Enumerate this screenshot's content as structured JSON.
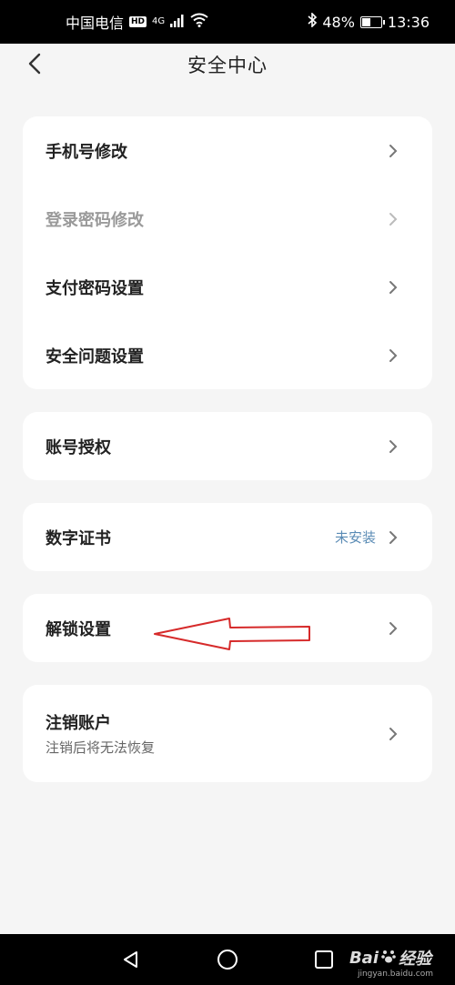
{
  "status_bar": {
    "carrier": "中国电信",
    "hd": "HD",
    "signal_type": "4G",
    "battery": "48%",
    "battery_level": 0.48,
    "time": "13:36"
  },
  "header": {
    "title": "安全中心"
  },
  "cards": {
    "account_group": {
      "items": [
        {
          "label": "手机号修改",
          "disabled": false
        },
        {
          "label": "登录密码修改",
          "disabled": true
        },
        {
          "label": "支付密码设置",
          "disabled": false
        },
        {
          "label": "安全问题设置",
          "disabled": false
        }
      ]
    },
    "authorization": {
      "label": "账号授权"
    },
    "certificate": {
      "label": "数字证书",
      "status": "未安装"
    },
    "unlock": {
      "label": "解锁设置"
    },
    "cancel_account": {
      "label": "注销账户",
      "sublabel": "注销后将无法恢复"
    }
  },
  "colors": {
    "background": "#f5f5f5",
    "card": "#ffffff",
    "status_link": "#5a8bb5",
    "annotation_arrow": "#d62a2a"
  },
  "watermark": {
    "brand": "Bai",
    "brand2": "经验",
    "site": "jingyan.baidu.com"
  }
}
